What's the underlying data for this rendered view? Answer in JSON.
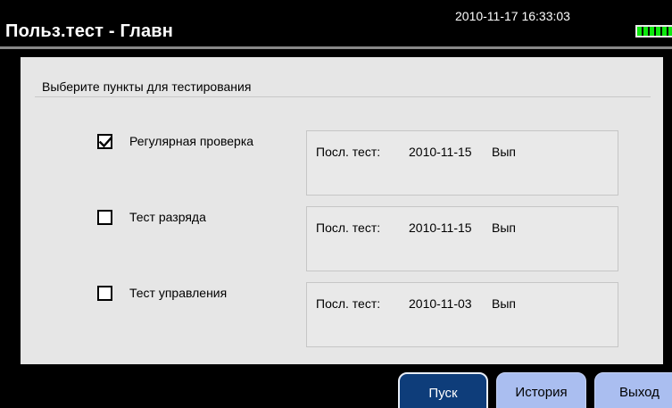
{
  "header": {
    "title": "Польз.тест - Главн",
    "datetime": "2010-11-17 16:33:03",
    "battery_level": 1.0
  },
  "panel": {
    "heading": "Выберите пункты для тестирования",
    "last_test_label": "Посл. тест:",
    "tests": [
      {
        "label": "Регулярная проверка",
        "checked": true,
        "last_date": "2010-11-15",
        "status": "Вып"
      },
      {
        "label": "Тест разряда",
        "checked": false,
        "last_date": "2010-11-15",
        "status": "Вып"
      },
      {
        "label": "Тест управления",
        "checked": false,
        "last_date": "2010-11-03",
        "status": "Вып"
      }
    ]
  },
  "buttons": {
    "start": "Пуск",
    "history": "История",
    "exit": "Выход"
  },
  "colors": {
    "background": "#000000",
    "panel": "#e6e6e6",
    "start_button": "#0e3d7a",
    "secondary_button": "#aabef0",
    "battery": "#0ee80e"
  }
}
